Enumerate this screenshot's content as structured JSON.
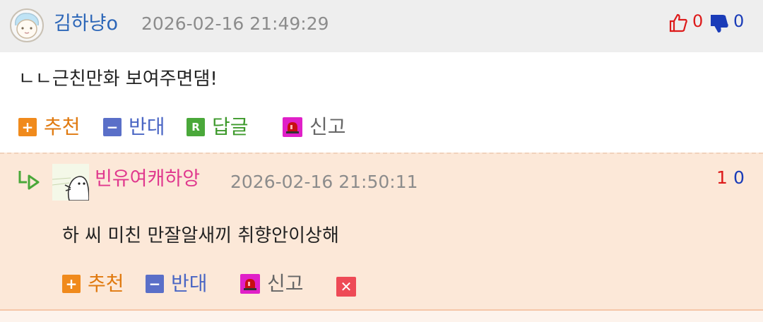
{
  "comment": {
    "author": "김하냥o",
    "timestamp": "2026-02-16 21:49:29",
    "upvotes": "0",
    "downvotes": "0",
    "text": "ㄴㄴ근친만화 보여주면댐!",
    "actions": {
      "recommend": "추천",
      "oppose": "반대",
      "reply": "답글",
      "reply_icon": "R",
      "report": "신고"
    }
  },
  "reply": {
    "author": "빈유여캐하앙",
    "timestamp": "2026-02-16 21:50:11",
    "upvotes": "1",
    "downvotes": "0",
    "text": "하 씨 미친 만잘알새끼 취향안이상해",
    "actions": {
      "recommend": "추천",
      "oppose": "반대",
      "report": "신고"
    }
  },
  "icons": {
    "recommend": "plus-icon",
    "oppose": "minus-icon",
    "report": "siren-icon",
    "delete": "close-icon",
    "thumbs_up": "thumbs-up-icon",
    "thumbs_down": "thumbs-down-icon",
    "reply_arrow": "reply-arrow-icon"
  },
  "colors": {
    "header_bg": "#eeeeee",
    "reply_bg": "#fce8d8",
    "author_blue": "#2c66b8",
    "author_pink": "#e0388e",
    "recommend": "#f08a1c",
    "oppose": "#5a6fc8",
    "reply": "#4aa83a",
    "report": "#e020c8",
    "up": "#dd1a1a",
    "down": "#1a3cb8"
  }
}
